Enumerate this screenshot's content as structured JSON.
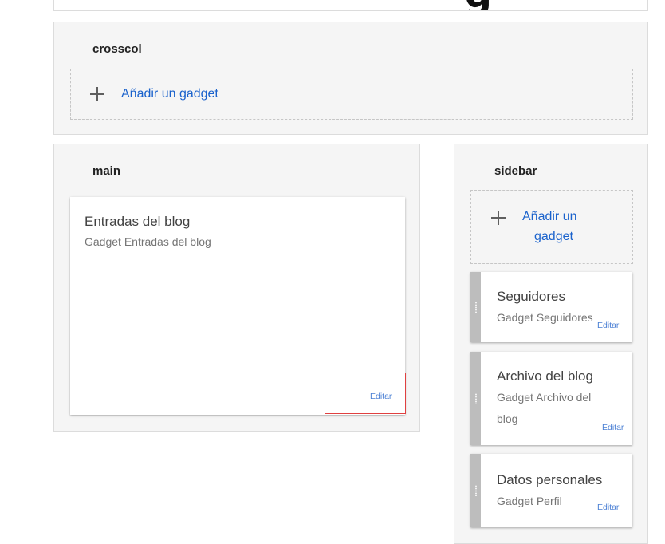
{
  "top_section": {
    "title_fragment": "g"
  },
  "crosscol": {
    "title": "crosscol",
    "add_gadget_label": "Añadir un gadget"
  },
  "main": {
    "title": "main",
    "gadgets": [
      {
        "title": "Entradas del blog",
        "subtitle": "Gadget Entradas del blog",
        "edit_label": "Editar"
      }
    ]
  },
  "sidebar": {
    "title": "sidebar",
    "add_gadget_line1": "Añadir un",
    "add_gadget_line2": "gadget",
    "gadgets": [
      {
        "title": "Seguidores",
        "subtitle_line1": "Gadget Seguidores",
        "edit_label": "Editar"
      },
      {
        "title": "Archivo del blog",
        "subtitle_line1": "Gadget Archivo del",
        "subtitle_line2": "blog",
        "edit_label": "Editar"
      },
      {
        "title": "Datos personales",
        "subtitle_line1": "Gadget Perfil",
        "edit_label": "Editar"
      }
    ]
  },
  "icons": {
    "add": "plus-icon",
    "drag": "drag-handle-icon"
  },
  "colors": {
    "link": "#1a62cc",
    "edit_link": "#4a7fd4",
    "highlight": "#e04040",
    "section_bg": "#f5f5f5",
    "drag_handle": "#bdbdbd"
  }
}
